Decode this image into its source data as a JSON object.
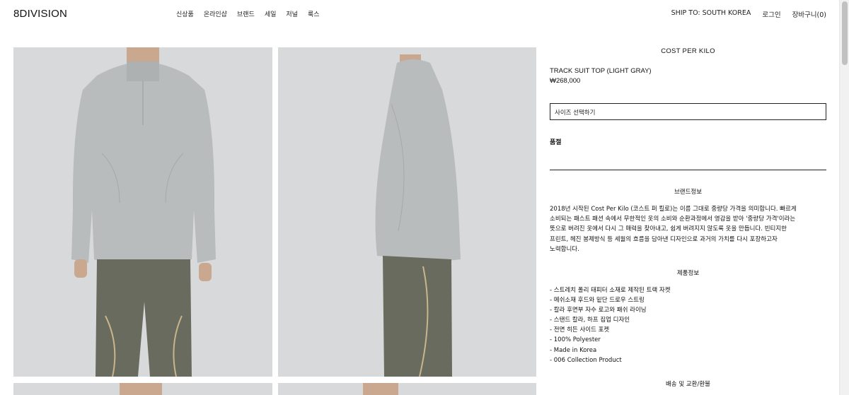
{
  "header": {
    "logo": "8DIVISION",
    "nav": [
      "신상품",
      "온라인샵",
      "브랜드",
      "세일",
      "저널",
      "룩스"
    ],
    "ship_to": "SHIP TO: SOUTH KOREA",
    "login": "로그인",
    "cart": "장바구니(0)"
  },
  "product": {
    "brand": "COST PER KILO",
    "name": "TRACK SUIT TOP (LIGHT GRAY)",
    "price": "₩268,000",
    "size_placeholder": "사이즈 선택하기",
    "qty_label": "품절"
  },
  "brand_info": {
    "title": "브랜드정보",
    "lines": [
      "2018년 시작된 Cost Per Kilo (코스트 퍼 킬로)는 이름 그대로 중량당 가격을 의미합니다. 빠르게",
      "소비되는 패스트 패션 속에서 무한적인 옷의 소비와 순환과정에서 영감을 받아 '중량당 가격'이라는",
      "뜻으로 버려진 옷에서 다시 그 매력을 찾아내고, 쉽게 버려지지 않도록 옷을 만듭니다. 빈티지한",
      "프린트, 헤진 봉제방식 등 세월의 흐름을 담아낸 디자인으로 과거의 가치를 다시 포장하고자",
      "노력합니다."
    ]
  },
  "product_info": {
    "title": "제품정보",
    "items": [
      "- 스트레치 폴리 태피터 소재로 제작된 트랙 자켓",
      "- 메쉬소재 후드와 밑단 드로우 스트링",
      "- 칼라 후면부 자수 로고와 패쉬 라이닝",
      "- 스탠드 칼라, 하프 집업 디자인",
      "- 전면 히든 사이드 포켓",
      "- 100% Polyester",
      "- Made in Korea",
      "- 006 Collection Product"
    ]
  },
  "shipping": {
    "title": "배송 및 교환/환불"
  },
  "colors": {
    "photo_bg": "#d8d9db",
    "jacket": "#b9bcbc",
    "pants": "#6a6b5f"
  }
}
